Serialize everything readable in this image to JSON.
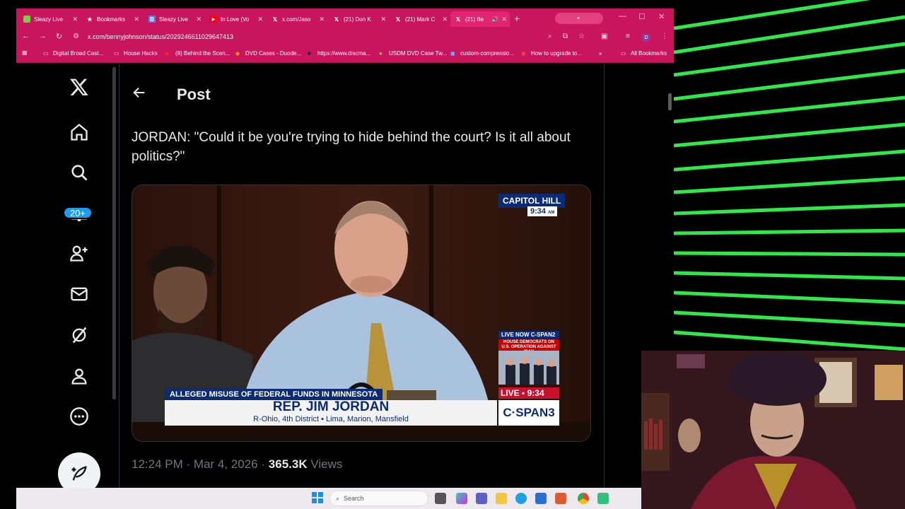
{
  "browser": {
    "tabs": [
      {
        "label": "Sleazy Live",
        "icon": "sleazy-live-icon",
        "color": "#7bd13c"
      },
      {
        "label": "Bookmarks",
        "icon": "star-icon",
        "color": "#ffffff"
      },
      {
        "label": "Sleazy Live",
        "icon": "bookmark-r-icon",
        "color": "#5b7cff"
      },
      {
        "label": "In Love (Vo",
        "icon": "youtube-icon",
        "color": "#ff0000"
      },
      {
        "label": "x.com/Jaso",
        "icon": "x-icon",
        "color": "#ffffff"
      },
      {
        "label": "(21) Don K",
        "icon": "x-icon",
        "color": "#ffffff"
      },
      {
        "label": "(21) Mark C",
        "icon": "x-icon",
        "color": "#ffffff"
      },
      {
        "label": "(21) Be",
        "icon": "x-icon",
        "color": "#ffffff"
      }
    ],
    "url": "x.com/bennyjohnson/status/2029246611029647413",
    "bookmarks": [
      "Digital Broad Cast...",
      "House Hacks",
      "(8) Behind the Scen...",
      "DVD Cases - Duode...",
      "https://www.discma...",
      "USDM DVD Case Tw...",
      "custom-compressio...",
      "How to upgrade to..."
    ],
    "all_bookmarks": "All Bookmarks",
    "profile_initial": "D",
    "accent_color": "#c8155e"
  },
  "x": {
    "header_title": "Post",
    "post_text": "JORDAN: \"Could it be you're trying to hide behind the court? Is it all about politics?\"",
    "notifications_badge": "20+",
    "time": "12:24 PM",
    "date": "Mar 4, 2026",
    "separator": "·",
    "views_count": "365.3K",
    "views_label": "Views",
    "nav_icons": [
      "x-logo-icon",
      "home-icon",
      "search-icon",
      "bell-icon",
      "people-icon",
      "mail-icon",
      "grok-icon",
      "profile-icon",
      "more-icon"
    ]
  },
  "video": {
    "location": "CAPITOL HILL",
    "clock": "9:34",
    "clock_suffix": "AM",
    "topic": "ALLEGED MISUSE OF FEDERAL FUNDS IN MINNESOTA",
    "name": "REP. JIM JORDAN",
    "district": "R-Ohio, 4th District  ▪  Lima, Marion, Mansfield",
    "live_now": "LIVE NOW C-SPAN2",
    "side_headline": "HOUSE DEMOCRATS ON U.S. OPERATION AGAINST IRAN",
    "live_label": "LIVE",
    "live_time": "9:34",
    "network": "C·SPAN3"
  },
  "taskbar": {
    "search_placeholder": "Search"
  }
}
